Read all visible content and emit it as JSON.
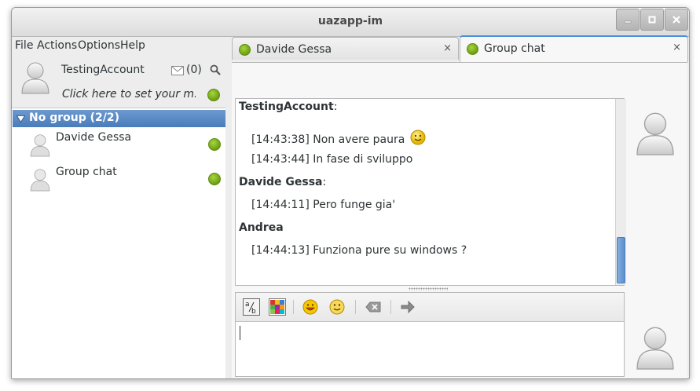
{
  "window": {
    "title": "uazapp-im"
  },
  "menu": {
    "items": [
      "File",
      "Actions",
      "Options",
      "Help"
    ]
  },
  "account": {
    "name": "TestingAccount",
    "mail_count": "(0)",
    "status_message": "Click here to set your m...",
    "status_color": "#7aab17"
  },
  "contacts": {
    "group": {
      "label": "No group (2/2)"
    },
    "items": [
      {
        "name": "Davide Gessa"
      },
      {
        "name": "Group chat"
      }
    ]
  },
  "tabs": [
    {
      "label": "Davide Gessa",
      "close": "×"
    },
    {
      "label": "Group chat",
      "close": "×"
    }
  ],
  "chat_log": [
    {
      "kind": "sender",
      "text": "TestingAccount",
      "suffix": ":"
    },
    {
      "kind": "msg",
      "text": "[14:43:38] Non avere paura",
      "smiley": true
    },
    {
      "kind": "msg",
      "text": "[14:43:44] In fase di sviluppo"
    },
    {
      "kind": "sender",
      "text": "Davide Gessa",
      "suffix": ":"
    },
    {
      "kind": "msg",
      "text": "[14:44:11] Pero funge gia'"
    },
    {
      "kind": "sender",
      "text": "Andrea",
      "suffix": ""
    },
    {
      "kind": "msg",
      "text": "[14:44:13] Funziona pure su windows ?"
    }
  ],
  "composer": {
    "tools": [
      "spell-check-icon",
      "color-palette-icon",
      "grin-smiley-icon",
      "smile-smiley-icon",
      "clear-icon",
      "send-arrow-icon"
    ]
  },
  "colors": {
    "accent": "#4a7cbb",
    "status_online": "#7aab17"
  }
}
